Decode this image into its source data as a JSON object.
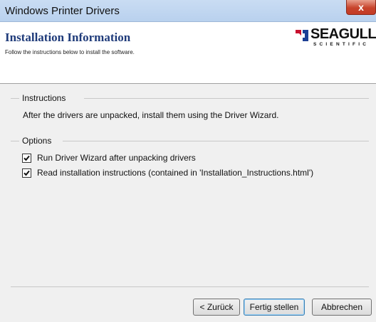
{
  "window": {
    "title": "Windows Printer Drivers",
    "close_glyph": "x"
  },
  "header": {
    "title": "Installation Information",
    "subtitle": "Follow the instructions below to install the software.",
    "logo": {
      "word": "SEAGULL",
      "sub": "SCIENTIFIC",
      "icon": "seagull-logo-icon"
    }
  },
  "instructions": {
    "legend": "Instructions",
    "text": "After the drivers are unpacked, install them using the Driver Wizard."
  },
  "options": {
    "legend": "Options",
    "items": [
      {
        "label": "Run Driver Wizard after unpacking drivers",
        "checked": true
      },
      {
        "label": "Read installation instructions (contained in 'Installation_Instructions.html')",
        "checked": true
      }
    ]
  },
  "buttons": {
    "back": "< Zurück",
    "finish": "Fertig stellen",
    "cancel": "Abbrechen"
  },
  "colors": {
    "title_accent": "#1f3b7a",
    "close_button": "#c7442c",
    "header_bg": "#ffffff",
    "dialog_bg": "#f0f0f0"
  }
}
